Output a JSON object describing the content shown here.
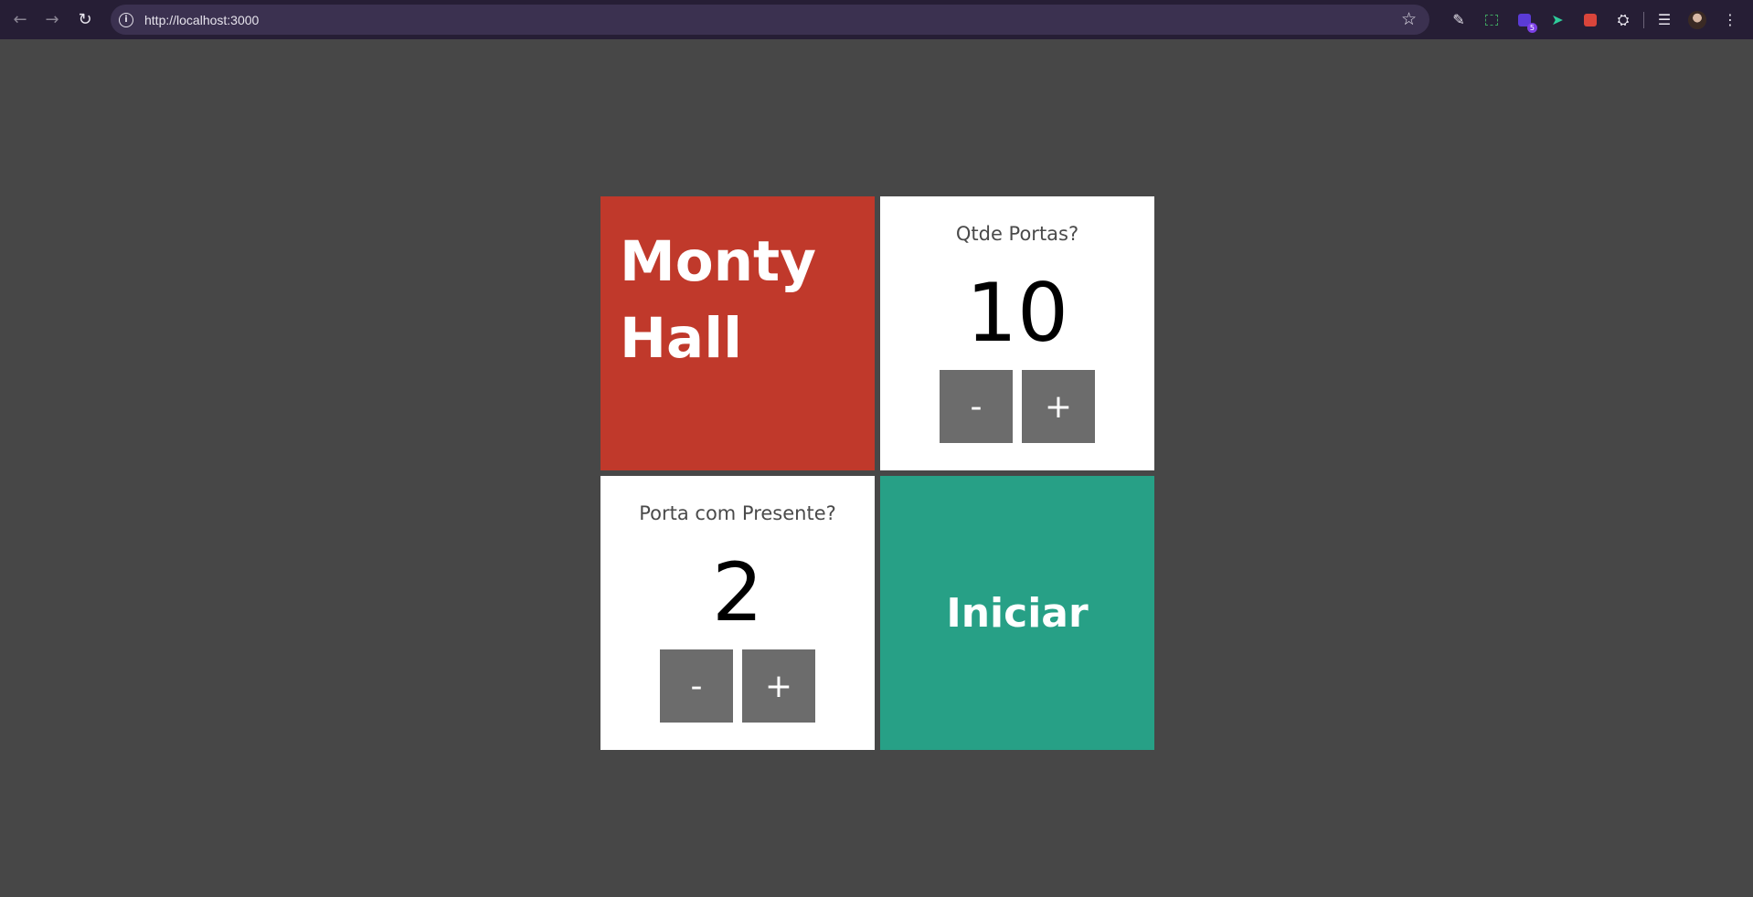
{
  "browser": {
    "url": "http://localhost:3000",
    "nav": {
      "back_icon": "arrow-left-icon",
      "forward_icon": "arrow-right-icon",
      "reload_icon": "reload-icon"
    },
    "extension_badge": "5"
  },
  "app": {
    "title": "Monty Hall",
    "doors": {
      "label": "Qtde Portas?",
      "value": "10",
      "minus": "-",
      "plus": "+"
    },
    "gift_door": {
      "label": "Porta com Presente?",
      "value": "2",
      "minus": "-",
      "plus": "+"
    },
    "start_label": "Iniciar",
    "colors": {
      "background": "#474747",
      "title_card": "#c0392b",
      "start_card": "#27a086",
      "stepper_button": "#6c6c6c"
    }
  }
}
